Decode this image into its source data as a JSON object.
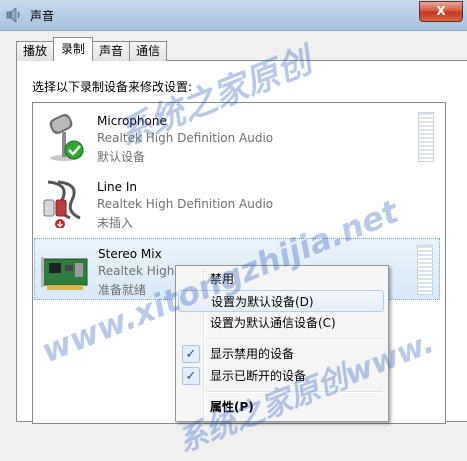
{
  "window": {
    "title": "声音",
    "close_label": "X"
  },
  "tabs": [
    {
      "label": "播放",
      "active": false
    },
    {
      "label": "录制",
      "active": true
    },
    {
      "label": "声音",
      "active": false
    },
    {
      "label": "通信",
      "active": false
    }
  ],
  "instruction": "选择以下录制设备来修改设置:",
  "devices": [
    {
      "name": "Microphone",
      "driver": "Realtek High Definition Audio",
      "status": "默认设备",
      "icon": "microphone-icon",
      "badge": "green-check-icon"
    },
    {
      "name": "Line In",
      "driver": "Realtek High Definition Audio",
      "status": "未插入",
      "icon": "line-in-cable-icon",
      "badge": "red-down-arrow-icon"
    },
    {
      "name": "Stereo Mix",
      "driver": "Realtek High",
      "status": "准备就绪",
      "icon": "sound-card-icon"
    }
  ],
  "menu": {
    "disable": "禁用",
    "set_default": "设置为默认设备(D)",
    "set_default_comm": "设置为默认通信设备(C)",
    "show_disabled": "显示禁用的设备",
    "show_disconnected": "显示已断开的设备",
    "properties": "属性(P)",
    "check_glyph": "✓"
  },
  "watermark": {
    "line1": "系统之家原创",
    "line2": "www.xitongzhijia.net",
    "line3": "系统之家原创www."
  }
}
